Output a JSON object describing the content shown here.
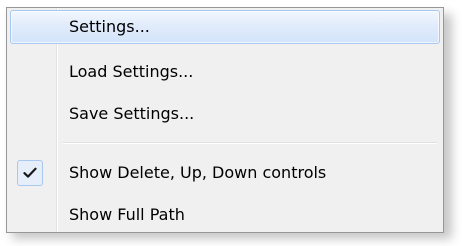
{
  "menu": {
    "items": [
      {
        "label": "Settings...",
        "highlighted": true,
        "checked": false
      },
      {
        "label": "Load Settings...",
        "highlighted": false,
        "checked": false
      },
      {
        "label": "Save Settings...",
        "highlighted": false,
        "checked": false
      },
      {
        "label": "Show Delete, Up, Down controls",
        "highlighted": false,
        "checked": true
      },
      {
        "label": "Show Full Path",
        "highlighted": false,
        "checked": false
      }
    ]
  },
  "icons": {
    "check": "checkmark-icon"
  },
  "colors": {
    "menu_background": "#f0f0f0",
    "highlight_border": "#a8c8ef",
    "highlight_fill": "#dce9fa",
    "text": "#000000"
  }
}
